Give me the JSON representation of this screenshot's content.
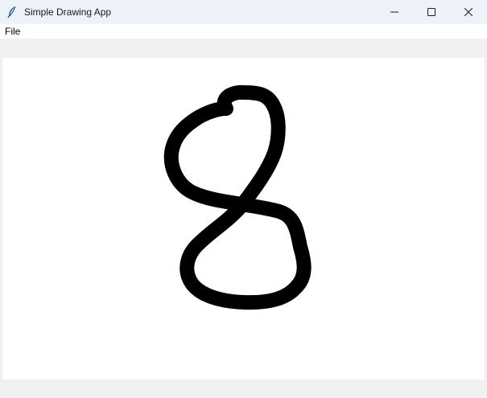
{
  "window": {
    "title": "Simple Drawing App",
    "icon": "feather-icon"
  },
  "controls": {
    "minimize_icon": "minimize-icon",
    "maximize_icon": "maximize-icon",
    "close_icon": "close-icon"
  },
  "menubar": {
    "items": [
      {
        "label": "File"
      }
    ]
  },
  "canvas": {
    "background": "#ffffff",
    "stroke_color": "#000000",
    "drawing": "freehand digit stroke"
  },
  "colors": {
    "titlebar_bg": "#eef2f9",
    "window_bg": "#f0f0f0",
    "icon_blue": "#1f5fb4"
  }
}
